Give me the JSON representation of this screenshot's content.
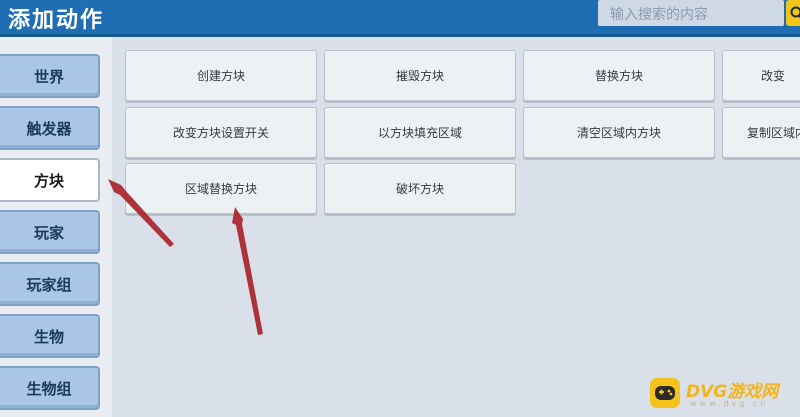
{
  "header": {
    "title": "添加动作",
    "search_placeholder": "输入搜索的内容",
    "search_icon": "search-icon"
  },
  "sidebar": {
    "items": [
      {
        "label": "世界",
        "active": false
      },
      {
        "label": "触发器",
        "active": false
      },
      {
        "label": "方块",
        "active": true
      },
      {
        "label": "玩家",
        "active": false
      },
      {
        "label": "玩家组",
        "active": false
      },
      {
        "label": "生物",
        "active": false
      },
      {
        "label": "生物组",
        "active": false
      }
    ]
  },
  "actions": {
    "rows": [
      [
        "创建方块",
        "摧毁方块",
        "替换方块",
        "改变"
      ],
      [
        "改变方块设置开关",
        "以方块填充区域",
        "清空区域内方块",
        "复制区域内方"
      ],
      [
        "区域替换方块",
        "破坏方块"
      ]
    ]
  },
  "annotations": {
    "arrow_color": "#a9232a"
  },
  "watermark": {
    "brand": "DVG游戏网",
    "url": "www.dvg.cn"
  },
  "colors": {
    "header_bg": "#1f6eb3",
    "sidebar_button": "#a9c6e4",
    "active_button": "#ffffff",
    "search_button": "#f2c51d"
  }
}
